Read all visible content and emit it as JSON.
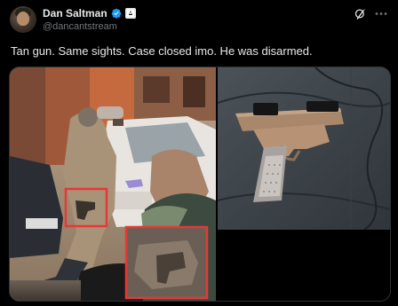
{
  "author": {
    "name": "Dan Saltman",
    "handle": "@dancantstream",
    "avatar_icon": "profile-photo",
    "verified_icon": "verified-badge-icon",
    "affiliation_icon": "affiliate-badge-icon"
  },
  "actions": {
    "grok_icon": "grok-icon",
    "more_icon": "more-options-icon"
  },
  "tweet": {
    "text": "Tan gun. Same sights. Case closed imo. He was disarmed."
  },
  "media": {
    "left_image": "street scene with highlighted gun in red boxes",
    "right_image": "tan handgun on dark car seat",
    "highlight_color": "#e53935"
  },
  "colors": {
    "background": "#000000",
    "text_primary": "#e7e9ea",
    "text_secondary": "#71767b",
    "verified_blue": "#1d9bf0"
  }
}
